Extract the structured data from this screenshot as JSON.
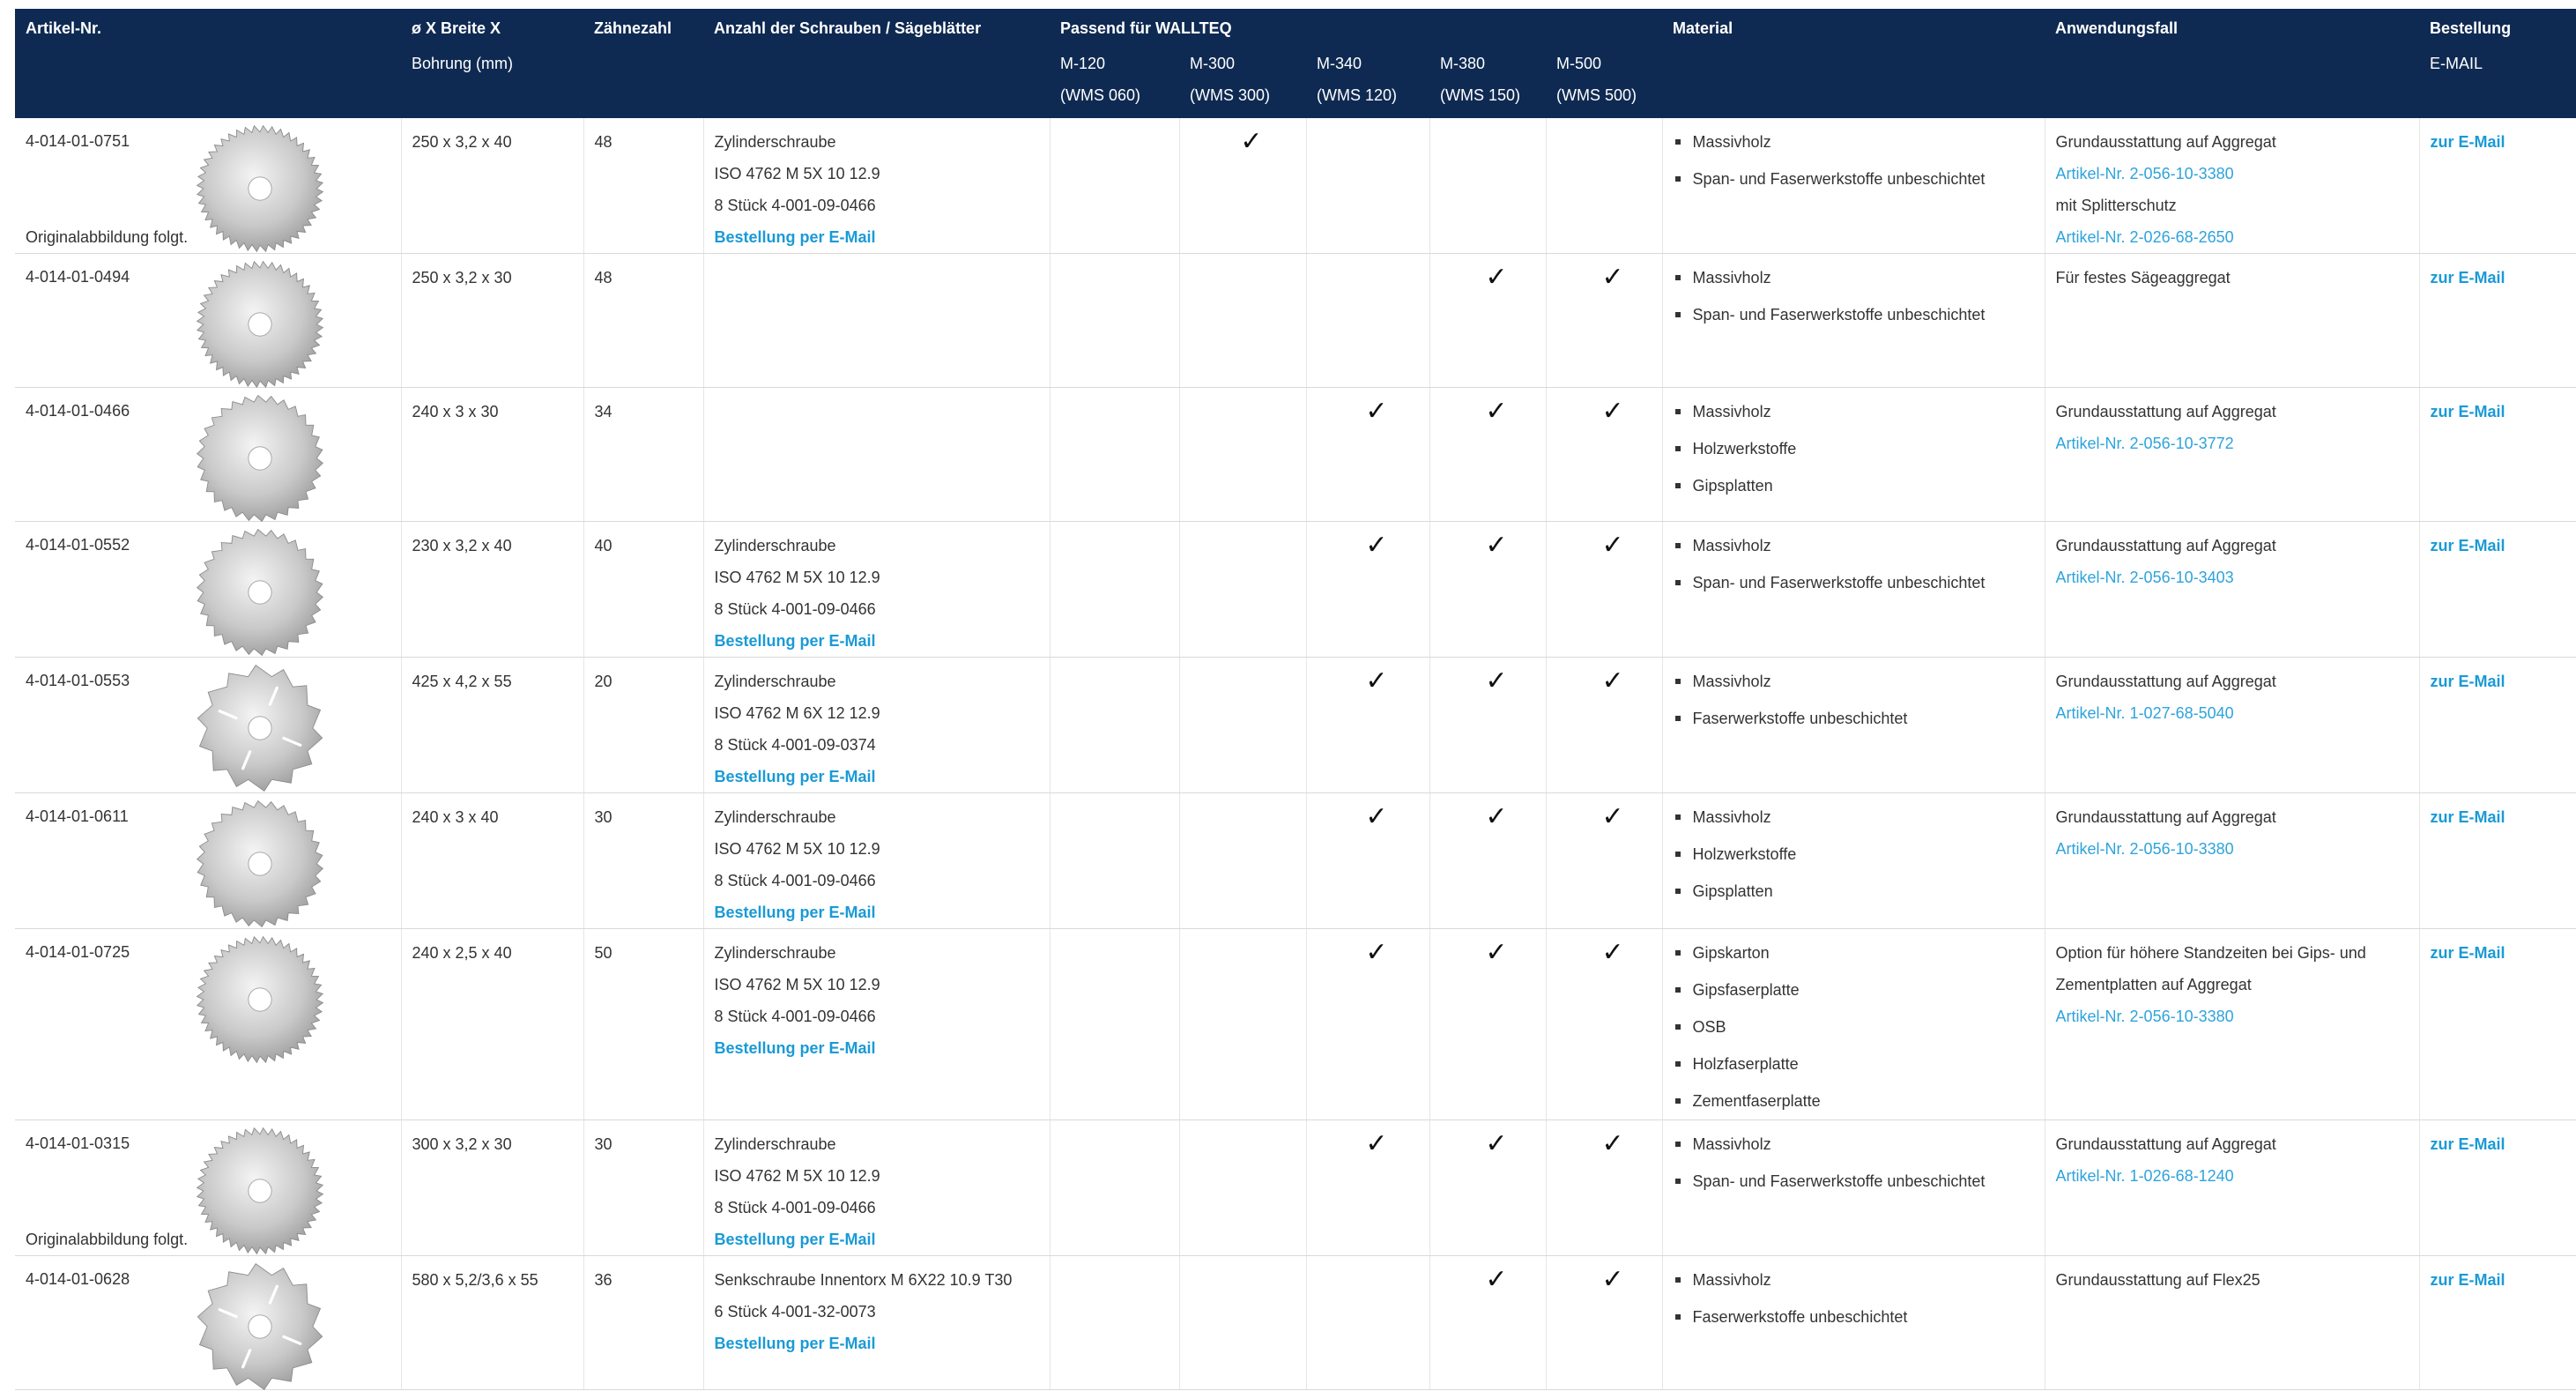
{
  "header": {
    "article": "Artikel-Nr.",
    "dim_title": "ø X Breite X",
    "dim_sub": "Bohrung (mm)",
    "teeth": "Zähnezahl",
    "screws": "Anzahl der Schrauben / Sägeblätter",
    "fits": "Passend für WALLTEQ",
    "models": [
      {
        "name": "M-120",
        "sub": "(WMS 060)"
      },
      {
        "name": "M-300",
        "sub": "(WMS 300)"
      },
      {
        "name": "M-340",
        "sub": "(WMS 120)"
      },
      {
        "name": "M-380",
        "sub": "(WMS 150)"
      },
      {
        "name": "M-500",
        "sub": "(WMS 500)"
      }
    ],
    "material": "Material",
    "usecase": "Anwendungsfall",
    "order": "Bestellung",
    "order_sub": "E-MAIL"
  },
  "check_glyph": "✓",
  "rows": [
    {
      "article": "4-014-01-0751",
      "note": "Originalabbildung folgt.",
      "blade_icon": "saw-blade-fine-icon",
      "dim": "250 x 3,2 x 40",
      "teeth": "48",
      "screws": [
        "Zylinderschraube",
        "ISO 4762 M 5X 10 12.9",
        "8 Stück 4-001-09-0466"
      ],
      "screw_link": "Bestellung per E-Mail",
      "fits": [
        false,
        true,
        false,
        false,
        false
      ],
      "materials": [
        "Massivholz",
        "Span- und Faserwerkstoffe unbeschichtet"
      ],
      "usecase": [
        {
          "text": "Grundausstattung auf Aggregat",
          "link": false
        },
        {
          "text": "Artikel-Nr. 2-056-10-3380",
          "link": true
        },
        {
          "text": "mit Splitterschutz",
          "link": false
        },
        {
          "text": "Artikel-Nr. 2-026-68-2650",
          "link": true
        }
      ],
      "order": "zur E-Mail"
    },
    {
      "article": "4-014-01-0494",
      "note": "",
      "blade_icon": "saw-blade-fine-icon",
      "dim": "250 x 3,2 x 30",
      "teeth": "48",
      "screws": [],
      "screw_link": "",
      "fits": [
        false,
        false,
        false,
        true,
        true
      ],
      "materials": [
        "Massivholz",
        "Span- und Faserwerkstoffe unbeschichtet"
      ],
      "usecase": [
        {
          "text": "Für festes Sägeaggregat",
          "link": false
        }
      ],
      "order": "zur E-Mail"
    },
    {
      "article": "4-014-01-0466",
      "note": "",
      "blade_icon": "saw-blade-icon",
      "dim": "240 x 3 x 30",
      "teeth": "34",
      "screws": [],
      "screw_link": "",
      "fits": [
        false,
        false,
        true,
        true,
        true
      ],
      "materials": [
        "Massivholz",
        "Holzwerkstoffe",
        "Gipsplatten"
      ],
      "usecase": [
        {
          "text": "Grundausstattung auf Aggregat",
          "link": false
        },
        {
          "text": "Artikel-Nr. 2-056-10-3772",
          "link": true
        }
      ],
      "order": "zur E-Mail"
    },
    {
      "article": "4-014-01-0552",
      "note": "",
      "blade_icon": "saw-blade-icon",
      "dim": "230 x 3,2 x 40",
      "teeth": "40",
      "screws": [
        "Zylinderschraube",
        "ISO 4762 M 5X 10 12.9",
        "8 Stück 4-001-09-0466"
      ],
      "screw_link": "Bestellung per E-Mail",
      "fits": [
        false,
        false,
        true,
        true,
        true
      ],
      "materials": [
        "Massivholz",
        "Span- und Faserwerkstoffe unbeschichtet"
      ],
      "usecase": [
        {
          "text": "Grundausstattung auf Aggregat",
          "link": false
        },
        {
          "text": "Artikel-Nr. 2-056-10-3403",
          "link": true
        }
      ],
      "order": "zur E-Mail"
    },
    {
      "article": "4-014-01-0553",
      "note": "",
      "blade_icon": "saw-blade-coarse-icon",
      "dim": "425 x 4,2 x 55",
      "teeth": "20",
      "screws": [
        "Zylinderschraube",
        "ISO 4762 M 6X 12 12.9",
        "8 Stück 4-001-09-0374"
      ],
      "screw_link": "Bestellung per E-Mail",
      "fits": [
        false,
        false,
        true,
        true,
        true
      ],
      "materials": [
        "Massivholz",
        "Faserwerkstoffe unbeschichtet"
      ],
      "usecase": [
        {
          "text": "Grundausstattung auf Aggregat",
          "link": false
        },
        {
          "text": "Artikel-Nr. 1-027-68-5040",
          "link": true
        }
      ],
      "order": "zur E-Mail"
    },
    {
      "article": "4-014-01-0611",
      "note": "",
      "blade_icon": "saw-blade-icon",
      "dim": "240 x 3 x 40",
      "teeth": "30",
      "screws": [
        "Zylinderschraube",
        "ISO 4762 M 5X 10 12.9",
        "8 Stück 4-001-09-0466"
      ],
      "screw_link": "Bestellung per E-Mail",
      "fits": [
        false,
        false,
        true,
        true,
        true
      ],
      "materials": [
        "Massivholz",
        "Holzwerkstoffe",
        "Gipsplatten"
      ],
      "usecase": [
        {
          "text": "Grundausstattung auf Aggregat",
          "link": false
        },
        {
          "text": "Artikel-Nr. 2-056-10-3380",
          "link": true
        }
      ],
      "order": "zur E-Mail"
    },
    {
      "article": "4-014-01-0725",
      "note": "",
      "blade_icon": "saw-blade-fine-icon",
      "dim": "240 x 2,5 x 40",
      "teeth": "50",
      "screws": [
        "Zylinderschraube",
        "ISO 4762 M 5X 10 12.9",
        "8 Stück 4-001-09-0466"
      ],
      "screw_link": "Bestellung per E-Mail",
      "fits": [
        false,
        false,
        true,
        true,
        true
      ],
      "materials": [
        "Gipskarton",
        "Gipsfaserplatte",
        "OSB",
        "Holzfaserplatte",
        "Zementfaserplatte"
      ],
      "usecase": [
        {
          "text": "Option für höhere Standzeiten bei Gips- und",
          "link": false
        },
        {
          "text": "Zementplatten auf Aggregat",
          "link": false
        },
        {
          "text": "Artikel-Nr. 2-056-10-3380",
          "link": true
        }
      ],
      "order": "zur E-Mail"
    },
    {
      "article": "4-014-01-0315",
      "note": "Originalabbildung folgt.",
      "blade_icon": "saw-blade-fine-icon",
      "dim": "300 x 3,2 x 30",
      "teeth": "30",
      "screws": [
        "Zylinderschraube",
        "ISO 4762 M 5X 10 12.9",
        "8 Stück 4-001-09-0466"
      ],
      "screw_link": "Bestellung per E-Mail",
      "fits": [
        false,
        false,
        true,
        true,
        true
      ],
      "materials": [
        "Massivholz",
        "Span- und Faserwerkstoffe unbeschichtet"
      ],
      "usecase": [
        {
          "text": "Grundausstattung auf Aggregat",
          "link": false
        },
        {
          "text": "Artikel-Nr. 1-026-68-1240",
          "link": true
        }
      ],
      "order": "zur E-Mail"
    },
    {
      "article": "4-014-01-0628",
      "note": "",
      "blade_icon": "saw-blade-coarse-icon",
      "dim": "580 x 5,2/3,6 x 55",
      "teeth": "36",
      "screws": [
        "Senkschraube Innentorx M 6X22 10.9 T30",
        "6 Stück 4-001-32-0073"
      ],
      "screw_link": "Bestellung per E-Mail",
      "fits": [
        false,
        false,
        false,
        true,
        true
      ],
      "materials": [
        "Massivholz",
        "Faserwerkstoffe unbeschichtet"
      ],
      "usecase": [
        {
          "text": "Grundausstattung auf Flex25",
          "link": false
        }
      ],
      "order": "zur E-Mail"
    }
  ],
  "colors": {
    "header_bg": "#0f2a52",
    "link": "#1a9ad6",
    "text": "#333333"
  }
}
